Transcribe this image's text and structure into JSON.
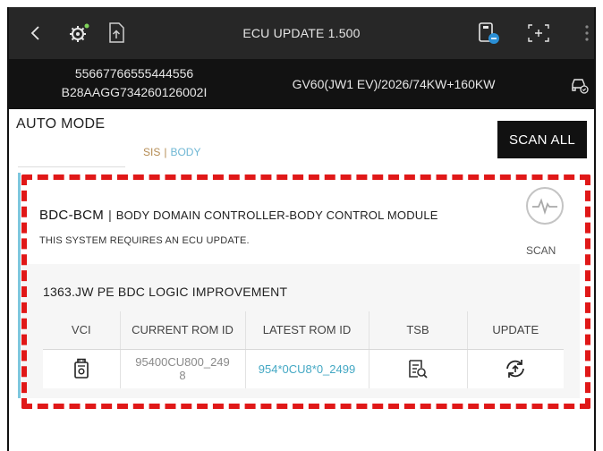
{
  "header": {
    "title": "ECU UPDATE 1.500",
    "back_icon": "back-arrow-icon",
    "icons": [
      "diagnostic-gear-icon",
      "document-upload-icon",
      "vci-connection-icon",
      "screen-capture-icon",
      "more-vertical-icon"
    ]
  },
  "vehicle": {
    "vin_line1": "55667766555444556",
    "vin_line2": "B28AAGG734260126002I",
    "model": "GV60(JW1 EV)/2026/74KW+160KW",
    "car_icon": "car-check-icon"
  },
  "mode": {
    "label": "AUTO MODE",
    "tab1": "SIS",
    "separator": "|",
    "tab2": "BODY",
    "scan_all_label": "SCAN ALL"
  },
  "system": {
    "code": "BDC-BCM",
    "separator": "|",
    "description": "BODY DOMAIN CONTROLLER-BODY CONTROL MODULE",
    "message": "THIS SYSTEM REQUIRES AN ECU UPDATE.",
    "scan_label": "SCAN",
    "scan_icon": "scan-waveform-icon"
  },
  "update": {
    "title": "1363.JW PE BDC LOGIC IMPROVEMENT",
    "columns": [
      "VCI",
      "CURRENT ROM ID",
      "LATEST ROM ID",
      "TSB",
      "UPDATE"
    ],
    "row": {
      "vci_icon": "vci-device-icon",
      "current_rom_line1": "95400CU800_249",
      "current_rom_line2": "8",
      "latest_rom": "954*0CU8*0_2499",
      "tsb_icon": "tsb-document-search-icon",
      "update_icon": "update-refresh-icon"
    }
  },
  "colors": {
    "topbar": "#272727",
    "infobar": "#121212",
    "accent_blue": "#44a8c4",
    "accent_gold": "#b58c53",
    "highlight_red": "#e01818"
  }
}
